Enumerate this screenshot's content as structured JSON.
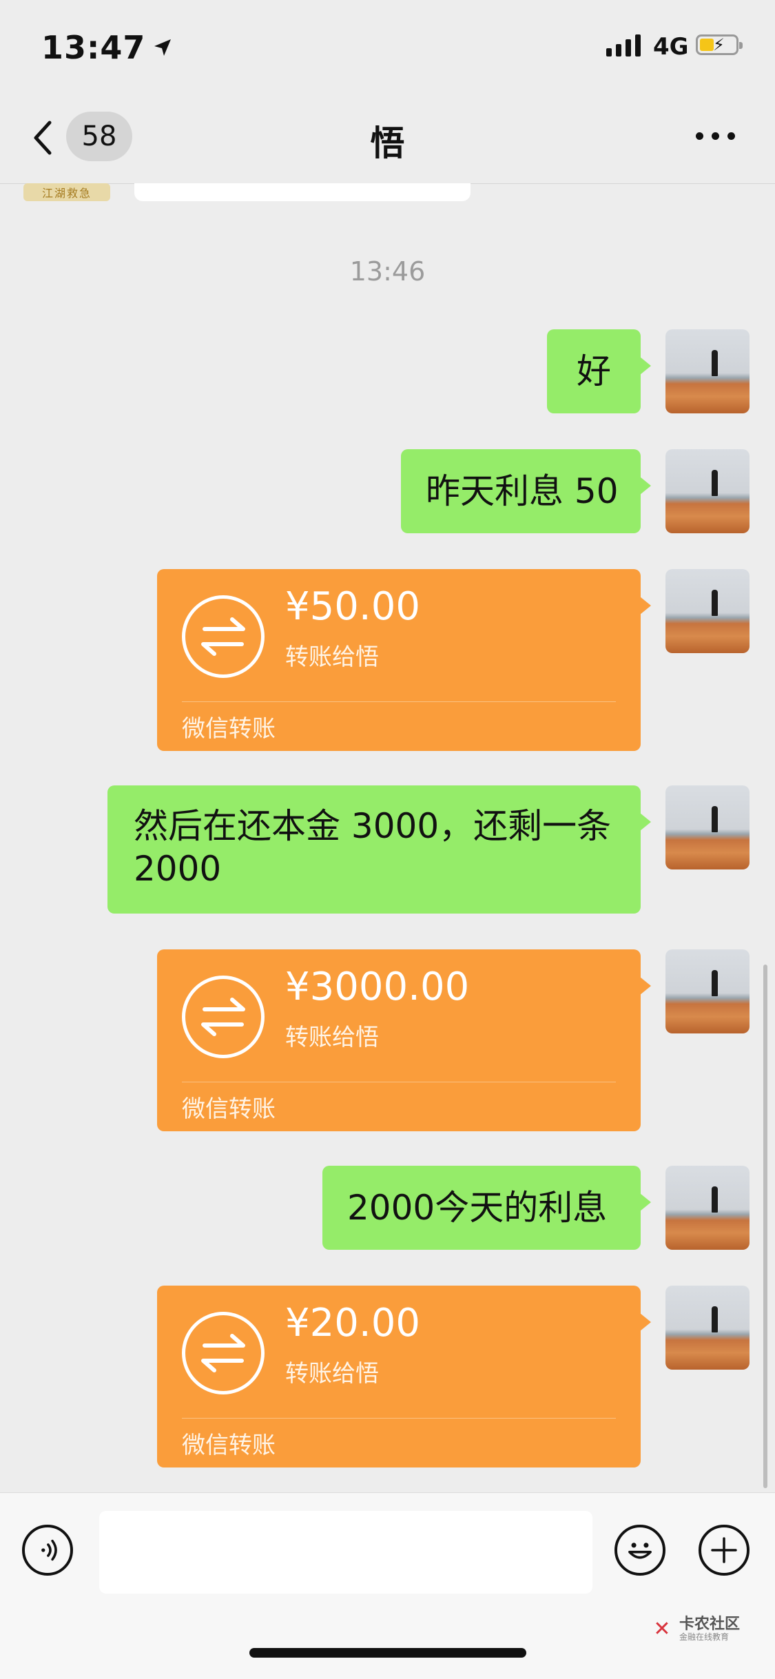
{
  "status_bar": {
    "time": "13:47",
    "network": "4G"
  },
  "header": {
    "unread_count": "58",
    "title": "悟"
  },
  "previous_tag": "江湖救急",
  "timestamp": "13:46",
  "messages": [
    {
      "type": "text",
      "text": "好"
    },
    {
      "type": "text",
      "text": "昨天利息 50"
    },
    {
      "type": "transfer",
      "amount": "¥50.00",
      "subtitle": "转账给悟",
      "footer": "微信转账"
    },
    {
      "type": "text",
      "text": "然后在还本金 3000，还剩一条 2000"
    },
    {
      "type": "transfer",
      "amount": "¥3000.00",
      "subtitle": "转账给悟",
      "footer": "微信转账"
    },
    {
      "type": "text",
      "text": "2000今天的利息"
    },
    {
      "type": "transfer",
      "amount": "¥20.00",
      "subtitle": "转账给悟",
      "footer": "微信转账"
    }
  ],
  "watermark": {
    "name": "卡农社区",
    "tagline": "金融在线教育"
  },
  "colors": {
    "bubble_green": "#95ec69",
    "transfer_orange": "#fa9d3b",
    "background": "#ededed"
  },
  "icons": [
    "location-arrow-icon",
    "signal-icon",
    "battery-charging-icon",
    "back-chevron-icon",
    "more-dots-icon",
    "transfer-arrows-icon",
    "voice-icon",
    "emoji-icon",
    "plus-icon"
  ]
}
